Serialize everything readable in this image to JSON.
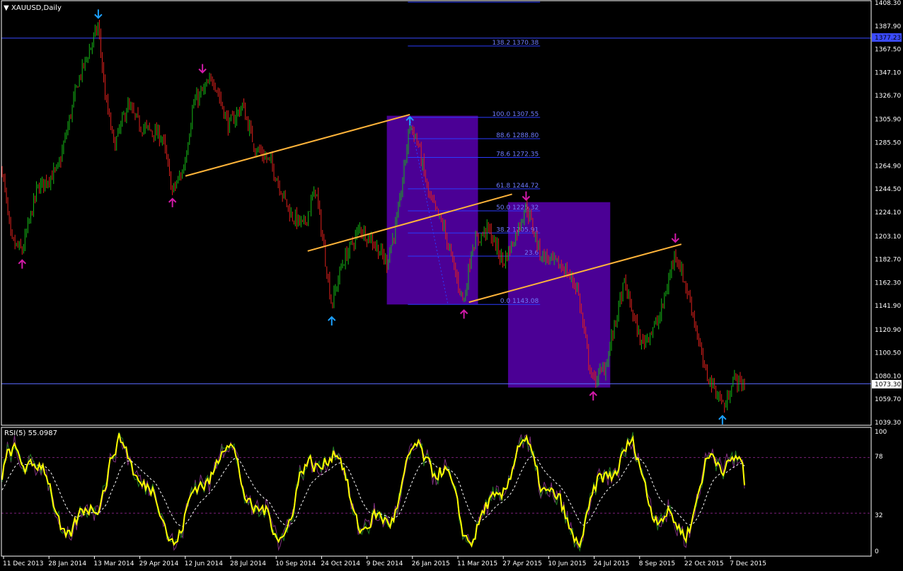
{
  "header": {
    "symbol_label": "XAUUSD,Daily",
    "menu_glyph": "▼"
  },
  "rsi_panel": {
    "label": "RSI(5) 55.0987",
    "levels": [
      "100",
      "78",
      "32",
      "0"
    ]
  },
  "colors": {
    "background": "#000000",
    "bull": "#16b916",
    "bear": "#e0211d",
    "zone": "#4b0095",
    "hline": "#3b4bff",
    "fib": "#2a3cff",
    "trend": "#ffb43a",
    "rsi_main": "#ffff00",
    "rsi_aux1": "#7d2f7d",
    "rsi_aux2": "#1f7a1f",
    "rsi_dash": "#ffffff",
    "arrow_up": "#1ca0ff",
    "arrow_down": "#d21aa8"
  },
  "price_labels": {
    "upper": "1377.23",
    "current": "1073.30"
  },
  "chart_data": [
    {
      "type": "candlestick",
      "title": "XAUUSD,Daily",
      "ylim": [
        1039.3,
        1408.3
      ],
      "y_ticks": [
        "1408.30",
        "1387.90",
        "1367.50",
        "1347.10",
        "1326.70",
        "1305.90",
        "1285.50",
        "1264.90",
        "1244.50",
        "1224.10",
        "1203.10",
        "1182.70",
        "1162.30",
        "1141.90",
        "1120.90",
        "1100.50",
        "1080.10",
        "1059.70",
        "1039.30"
      ],
      "x_ticks": [
        "11 Dec 2013",
        "28 Jan 2014",
        "13 Mar 2014",
        "29 Apr 2014",
        "12 Jun 2014",
        "28 Jul 2014",
        "10 Sep 2014",
        "24 Oct 2014",
        "9 Dec 2014",
        "26 Jan 2015",
        "11 Mar 2015",
        "27 Apr 2015",
        "10 Jun 2015",
        "24 Jul 2015",
        "8 Sep 2015",
        "22 Oct 2015",
        "7 Dec 2015"
      ],
      "x_range": [
        "2013-12-11",
        "2015-12-22"
      ],
      "anchors": [
        [
          "2013-12-11",
          1262
        ],
        [
          "2013-12-20",
          1198
        ],
        [
          "2013-12-31",
          1190
        ],
        [
          "2014-01-15",
          1245
        ],
        [
          "2014-02-05",
          1262
        ],
        [
          "2014-02-25",
          1340
        ],
        [
          "2014-03-17",
          1388
        ],
        [
          "2014-03-24",
          1325
        ],
        [
          "2014-04-02",
          1282
        ],
        [
          "2014-04-15",
          1318
        ],
        [
          "2014-04-28",
          1300
        ],
        [
          "2014-05-10",
          1295
        ],
        [
          "2014-05-20",
          1290
        ],
        [
          "2014-05-30",
          1242
        ],
        [
          "2014-06-10",
          1262
        ],
        [
          "2014-06-20",
          1320
        ],
        [
          "2014-07-10",
          1342
        ],
        [
          "2014-07-25",
          1300
        ],
        [
          "2014-08-08",
          1318
        ],
        [
          "2014-08-20",
          1282
        ],
        [
          "2014-09-05",
          1268
        ],
        [
          "2014-09-25",
          1222
        ],
        [
          "2014-10-08",
          1212
        ],
        [
          "2014-10-20",
          1245
        ],
        [
          "2014-11-05",
          1142
        ],
        [
          "2014-11-15",
          1178
        ],
        [
          "2014-12-03",
          1210
        ],
        [
          "2014-12-15",
          1200
        ],
        [
          "2014-12-30",
          1180
        ],
        [
          "2015-01-10",
          1220
        ],
        [
          "2015-01-22",
          1302
        ],
        [
          "2015-01-30",
          1285
        ],
        [
          "2015-02-10",
          1238
        ],
        [
          "2015-02-25",
          1210
        ],
        [
          "2015-03-10",
          1165
        ],
        [
          "2015-03-17",
          1145
        ],
        [
          "2015-03-25",
          1195
        ],
        [
          "2015-04-10",
          1210
        ],
        [
          "2015-04-25",
          1180
        ],
        [
          "2015-05-05",
          1198
        ],
        [
          "2015-05-18",
          1230
        ],
        [
          "2015-06-01",
          1188
        ],
        [
          "2015-06-15",
          1180
        ],
        [
          "2015-06-25",
          1175
        ],
        [
          "2015-07-08",
          1158
        ],
        [
          "2015-07-20",
          1090
        ],
        [
          "2015-07-24",
          1075
        ],
        [
          "2015-08-05",
          1088
        ],
        [
          "2015-08-24",
          1162
        ],
        [
          "2015-09-10",
          1108
        ],
        [
          "2015-09-28",
          1130
        ],
        [
          "2015-10-14",
          1190
        ],
        [
          "2015-10-30",
          1142
        ],
        [
          "2015-11-12",
          1085
        ],
        [
          "2015-12-03",
          1052
        ],
        [
          "2015-12-10",
          1078
        ],
        [
          "2015-12-22",
          1072
        ]
      ]
    },
    {
      "type": "line",
      "title": "RSI(5) 55.0987",
      "ylim": [
        0,
        100
      ],
      "y_ticks": [
        "100",
        "78",
        "32",
        "0"
      ],
      "levels": [
        78,
        32
      ],
      "last_value": 55.0987
    }
  ],
  "fibonacci": [
    {
      "label": "138.2 1370.38",
      "price": 1370.38
    },
    {
      "label": "100.0 1307.55",
      "price": 1307.55
    },
    {
      "label": "88.6 1288.80",
      "price": 1288.8
    },
    {
      "label": "78.6 1272.35",
      "price": 1272.35
    },
    {
      "label": "61.8 1244.72",
      "price": 1244.72
    },
    {
      "label": "50.0 1225.32",
      "price": 1225.32
    },
    {
      "label": "38.2 1205.91",
      "price": 1205.91
    },
    {
      "label": "23.6",
      "price": 1185.5
    },
    {
      "label": "0.0 1143.08",
      "price": 1143.08
    }
  ],
  "zones": [
    {
      "from": "2014-12-30",
      "to": "2015-03-31",
      "top": 1309,
      "bottom": 1143
    },
    {
      "from": "2015-04-30",
      "to": "2015-08-10",
      "top": 1233,
      "bottom": 1070
    }
  ],
  "trendlines": [
    {
      "from": [
        "2014-06-12",
        1256
      ],
      "to": [
        "2015-01-22",
        1310
      ]
    },
    {
      "from": [
        "2014-10-12",
        1190
      ],
      "to": [
        "2015-05-04",
        1240
      ]
    },
    {
      "from": [
        "2015-03-22",
        1145
      ],
      "to": [
        "2015-10-20",
        1196
      ]
    }
  ],
  "arrows": [
    {
      "date": "2014-03-17",
      "price": 1395,
      "dir": "down",
      "color": "arrow_up"
    },
    {
      "date": "2013-12-31",
      "price": 1182,
      "dir": "up",
      "color": "arrow_down"
    },
    {
      "date": "2014-05-30",
      "price": 1236,
      "dir": "up",
      "color": "arrow_down"
    },
    {
      "date": "2014-06-29",
      "price": 1347,
      "dir": "down",
      "color": "arrow_down"
    },
    {
      "date": "2014-11-05",
      "price": 1132,
      "dir": "up",
      "color": "arrow_up"
    },
    {
      "date": "2015-01-22",
      "price": 1308,
      "dir": "up",
      "color": "arrow_up"
    },
    {
      "date": "2015-03-17",
      "price": 1138,
      "dir": "up",
      "color": "arrow_down"
    },
    {
      "date": "2015-05-18",
      "price": 1235,
      "dir": "down",
      "color": "arrow_down"
    },
    {
      "date": "2015-07-24",
      "price": 1066,
      "dir": "up",
      "color": "arrow_down"
    },
    {
      "date": "2015-10-14",
      "price": 1198,
      "dir": "down",
      "color": "arrow_down"
    },
    {
      "date": "2015-11-30",
      "price": 1045,
      "dir": "up",
      "color": "arrow_up"
    }
  ]
}
